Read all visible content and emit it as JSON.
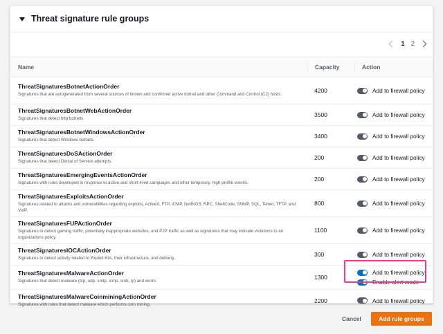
{
  "panel": {
    "title": "Threat signature rule groups",
    "pagination": {
      "pages": [
        "1",
        "2"
      ],
      "current": "1"
    }
  },
  "table": {
    "columns": {
      "name": "Name",
      "capacity": "Capacity",
      "action": "Action"
    },
    "rows": [
      {
        "name": "ThreatSignaturesBotnetActionOrder",
        "description": "Signatures that are autogenerated from several sources of known and confirmed active botnet and other Command and Control (C2) hosts.",
        "capacity": "4200",
        "actions": [
          "Add to firewall policy"
        ]
      },
      {
        "name": "ThreatSignaturesBotnetWebActionOrder",
        "description": "Signatures that detect http botnets.",
        "capacity": "3500",
        "actions": [
          "Add to firewall policy"
        ]
      },
      {
        "name": "ThreatSignaturesBotnetWindowsActionOrder",
        "description": "Signatures that detect Windows botnets.",
        "capacity": "3400",
        "actions": [
          "Add to firewall policy"
        ]
      },
      {
        "name": "ThreatSignaturesDoSActionOrder",
        "description": "Signatures that detect Denial of Service attempts.",
        "capacity": "200",
        "actions": [
          "Add to firewall policy"
        ]
      },
      {
        "name": "ThreatSignaturesEmergingEventsActionOrder",
        "description": "Signatures with rules developed in response to active and short-lived campaigns and other temporary, high-profile events.",
        "capacity": "200",
        "actions": [
          "Add to firewall policy"
        ]
      },
      {
        "name": "ThreatSignaturesExploitsActionOrder",
        "description": "Signatures related to attacks and vulnerabilities regarding exploits, ActiveX, FTP, ICMP, NetBIOS, RPC, ShellCode, SNMP, SQL, Telnet, TFTP, and VoIP.",
        "capacity": "800",
        "actions": [
          "Add to firewall policy"
        ]
      },
      {
        "name": "ThreatSignaturesFUPActionOrder",
        "description": "Signatures to detect gaming traffic, potentially inappropriate websites, and P2P traffic as well as signatures that may indicate violations to an organizations policy.",
        "capacity": "1100",
        "actions": [
          "Add to firewall policy"
        ]
      },
      {
        "name": "ThreatSignaturesIOCActionOrder",
        "description": "Signatures to detect activity related to Exploit Kits, their infrastructure, and delivery.",
        "capacity": "300",
        "actions": [
          "Add to firewall policy"
        ]
      },
      {
        "name": "ThreatSignaturesMalwareActionOrder",
        "description": "Signatures that detect malware (tcp, udp, smtp, icmp, smb, ip) and worm.",
        "capacity": "1300",
        "actions": [
          "Add to firewall policy",
          "Enable alert mode"
        ]
      },
      {
        "name": "ThreatSignaturesMalwareCoinminingActionOrder",
        "description": "Signatures with rules that detect malware which performs coin mining.",
        "capacity": "2200",
        "actions": [
          "Add to firewall policy"
        ]
      }
    ]
  },
  "footer": {
    "cancel_label": "Cancel",
    "add_label": "Add rule groups"
  },
  "colors": {
    "toggle_on": "#0073bb",
    "toggle_off": "#545b64",
    "primary_button": "#ec7211",
    "highlight": "#ec3a8f"
  }
}
